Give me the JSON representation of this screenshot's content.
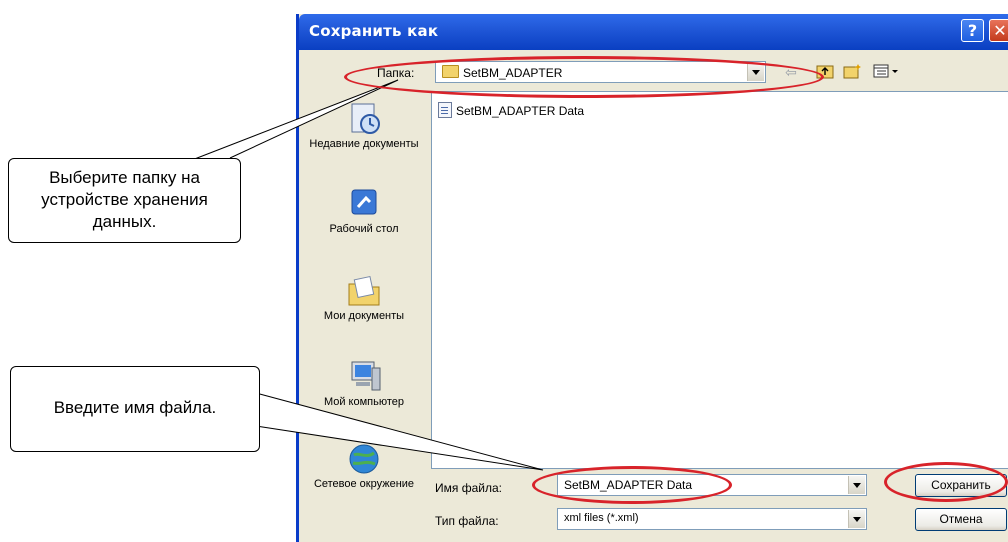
{
  "dialog": {
    "title": "Сохранить как",
    "help_button": "?",
    "close_button": "✕"
  },
  "toolbar": {
    "folder_label": "Папка:",
    "folder_value": "SetBM_ADAPTER",
    "icons": [
      "back-arrow-icon",
      "up-folder-icon",
      "new-folder-icon",
      "view-menu-icon"
    ]
  },
  "places": [
    {
      "label": "Недавние документы",
      "icon": "recent-documents-icon"
    },
    {
      "label": "Рабочий стол",
      "icon": "desktop-icon"
    },
    {
      "label": "Мои документы",
      "icon": "my-documents-icon"
    },
    {
      "label": "Мой компьютер",
      "icon": "my-computer-icon"
    },
    {
      "label": "Сетевое окружение",
      "icon": "network-icon"
    }
  ],
  "files": [
    {
      "name": "SetBM_ADAPTER Data",
      "icon": "data-file-icon"
    }
  ],
  "form": {
    "filename_label": "Имя файла:",
    "filename_value": "SetBM_ADAPTER Data",
    "filetype_label": "Тип файла:",
    "filetype_value": "xml files (*.xml)"
  },
  "buttons": {
    "save": "Сохранить",
    "cancel": "Отмена"
  },
  "callouts": {
    "folder": "Выберите папку на устройстве хранения данных.",
    "filename": "Введите имя файла."
  },
  "colors": {
    "highlight": "#d8232a",
    "titlebar": "#1f56d6",
    "dialog_bg": "#ece9d8"
  }
}
